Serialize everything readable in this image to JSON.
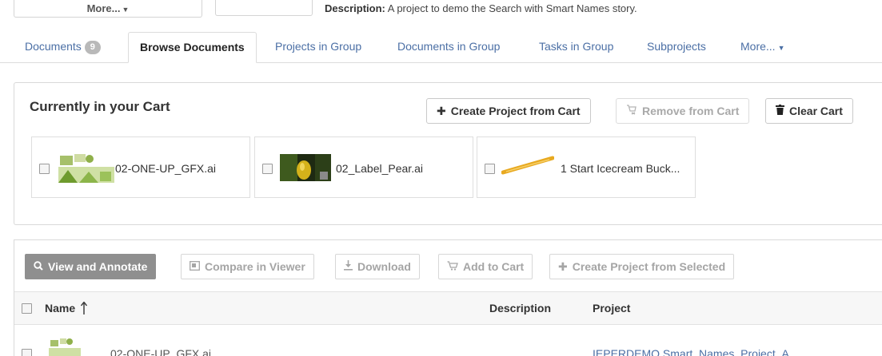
{
  "top": {
    "more_label": "More...",
    "description_label": "Description:",
    "description_text": "A project to demo the Search with Smart Names story."
  },
  "tabs": [
    {
      "label": "Documents",
      "badge": "9"
    },
    {
      "label": "Browse Documents"
    },
    {
      "label": "Projects in Group"
    },
    {
      "label": "Documents in Group"
    },
    {
      "label": "Tasks in Group"
    },
    {
      "label": "Subprojects"
    },
    {
      "label": "More..."
    }
  ],
  "cart": {
    "title": "Currently in your Cart",
    "create_label": "Create Project from Cart",
    "remove_label": "Remove from Cart",
    "clear_label": "Clear Cart",
    "items": [
      {
        "name": "02-ONE-UP_GFX.ai"
      },
      {
        "name": "02_Label_Pear.ai"
      },
      {
        "name": "1 Start Icecream Buck..."
      }
    ]
  },
  "toolbar": {
    "view_label": "View and Annotate",
    "compare_label": "Compare in Viewer",
    "download_label": "Download",
    "add_cart_label": "Add to Cart",
    "create_selected_label": "Create Project from Selected"
  },
  "table": {
    "columns": {
      "name": "Name",
      "description": "Description",
      "project": "Project"
    },
    "rows": [
      {
        "name": "02-ONE-UP_GFX.ai",
        "project": "IEPERDEMO Smart_Names_Project_A"
      }
    ]
  },
  "colors": {
    "link": "#4b6fa5",
    "primary_button": "#8f8f8f",
    "badge": "#b9b9b9"
  }
}
